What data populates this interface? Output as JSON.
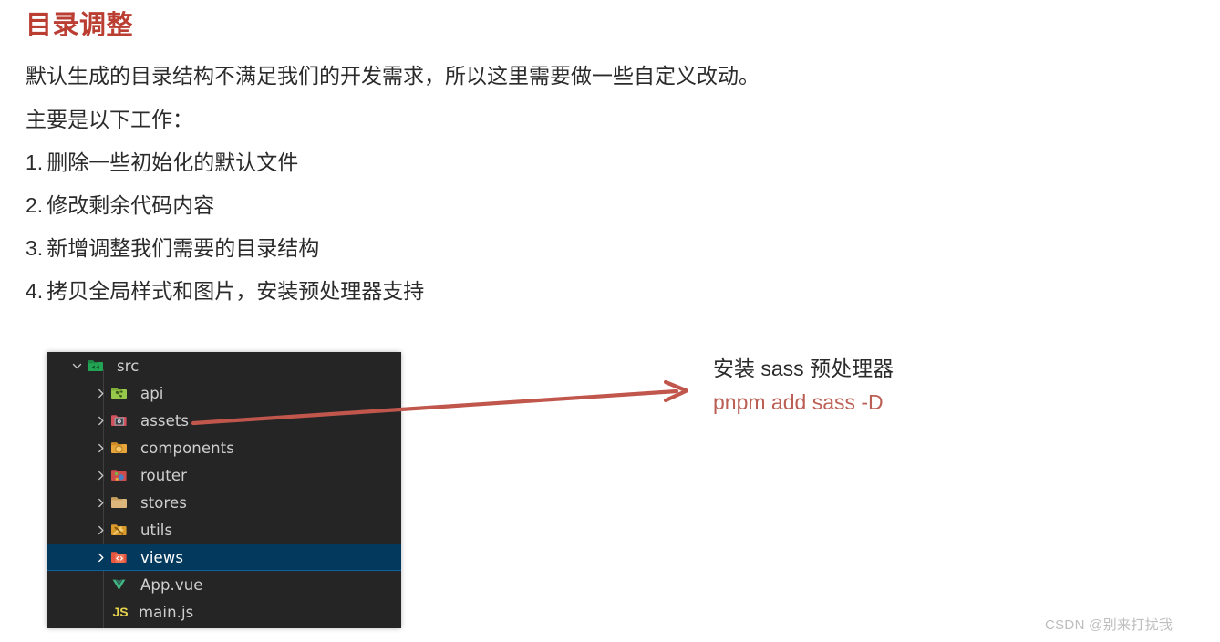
{
  "document": {
    "title": "目录调整",
    "title_color": "#bb3e33",
    "paragraphs": [
      "默认生成的目录结构不满足我们的开发需求，所以这里需要做一些自定义改动。",
      "主要是以下工作："
    ],
    "list": [
      {
        "num": "1.",
        "text": "删除一些初始化的默认文件"
      },
      {
        "num": "2.",
        "text": "修改剩余代码内容"
      },
      {
        "num": "3.",
        "text": "新增调整我们需要的目录结构"
      },
      {
        "num": "4.",
        "text": "拷贝全局样式和图片，安装预处理器支持"
      }
    ]
  },
  "explorer": {
    "background_color": "#252526",
    "selection_color": "#04395e",
    "selection_border_color": "#0a639e",
    "text_color": "#cfcfcf",
    "rows": [
      {
        "label": "src",
        "kind": "folder",
        "expanded": true,
        "level": 1,
        "icon": "folder-src-icon",
        "icon_color": "#1f9e4f",
        "selected": false
      },
      {
        "label": "api",
        "kind": "folder",
        "expanded": false,
        "level": 2,
        "icon": "folder-api-icon",
        "icon_color": "#8bc34a",
        "selected": false
      },
      {
        "label": "assets",
        "kind": "folder",
        "expanded": false,
        "level": 2,
        "icon": "folder-assets-icon",
        "icon_color": "#d9656b",
        "selected": false
      },
      {
        "label": "components",
        "kind": "folder",
        "expanded": false,
        "level": 2,
        "icon": "folder-components-icon",
        "icon_color": "#e8a33d",
        "selected": false
      },
      {
        "label": "router",
        "kind": "folder",
        "expanded": false,
        "level": 2,
        "icon": "folder-router-icon",
        "icon_color": "#cf4f4f",
        "selected": false
      },
      {
        "label": "stores",
        "kind": "folder",
        "expanded": false,
        "level": 2,
        "icon": "folder-stores-icon",
        "icon_color": "#dcb67a",
        "selected": false
      },
      {
        "label": "utils",
        "kind": "folder",
        "expanded": false,
        "level": 2,
        "icon": "folder-utils-icon",
        "icon_color": "#e8a33d",
        "selected": false
      },
      {
        "label": "views",
        "kind": "folder",
        "expanded": false,
        "level": 2,
        "icon": "folder-views-icon",
        "icon_color": "#e8563f",
        "selected": true
      },
      {
        "label": "App.vue",
        "kind": "file",
        "level": 2,
        "icon": "vue-file-icon",
        "icon_text": "V",
        "icon_color": "#41b883",
        "selected": false
      },
      {
        "label": "main.js",
        "kind": "file",
        "level": 2,
        "icon": "js-file-icon",
        "icon_text": "JS",
        "icon_color": "#e8d44d",
        "selected": false
      }
    ]
  },
  "annotation": {
    "line1": "安装 sass 预处理器",
    "line1_color": "#2b2b2b",
    "line2": "pnpm add sass -D",
    "line2_color": "#bb5f55",
    "arrow_color": "#c0564c",
    "arrow_name": "red-arrow-icon"
  },
  "watermark": {
    "text": "CSDN @别来打扰我"
  }
}
